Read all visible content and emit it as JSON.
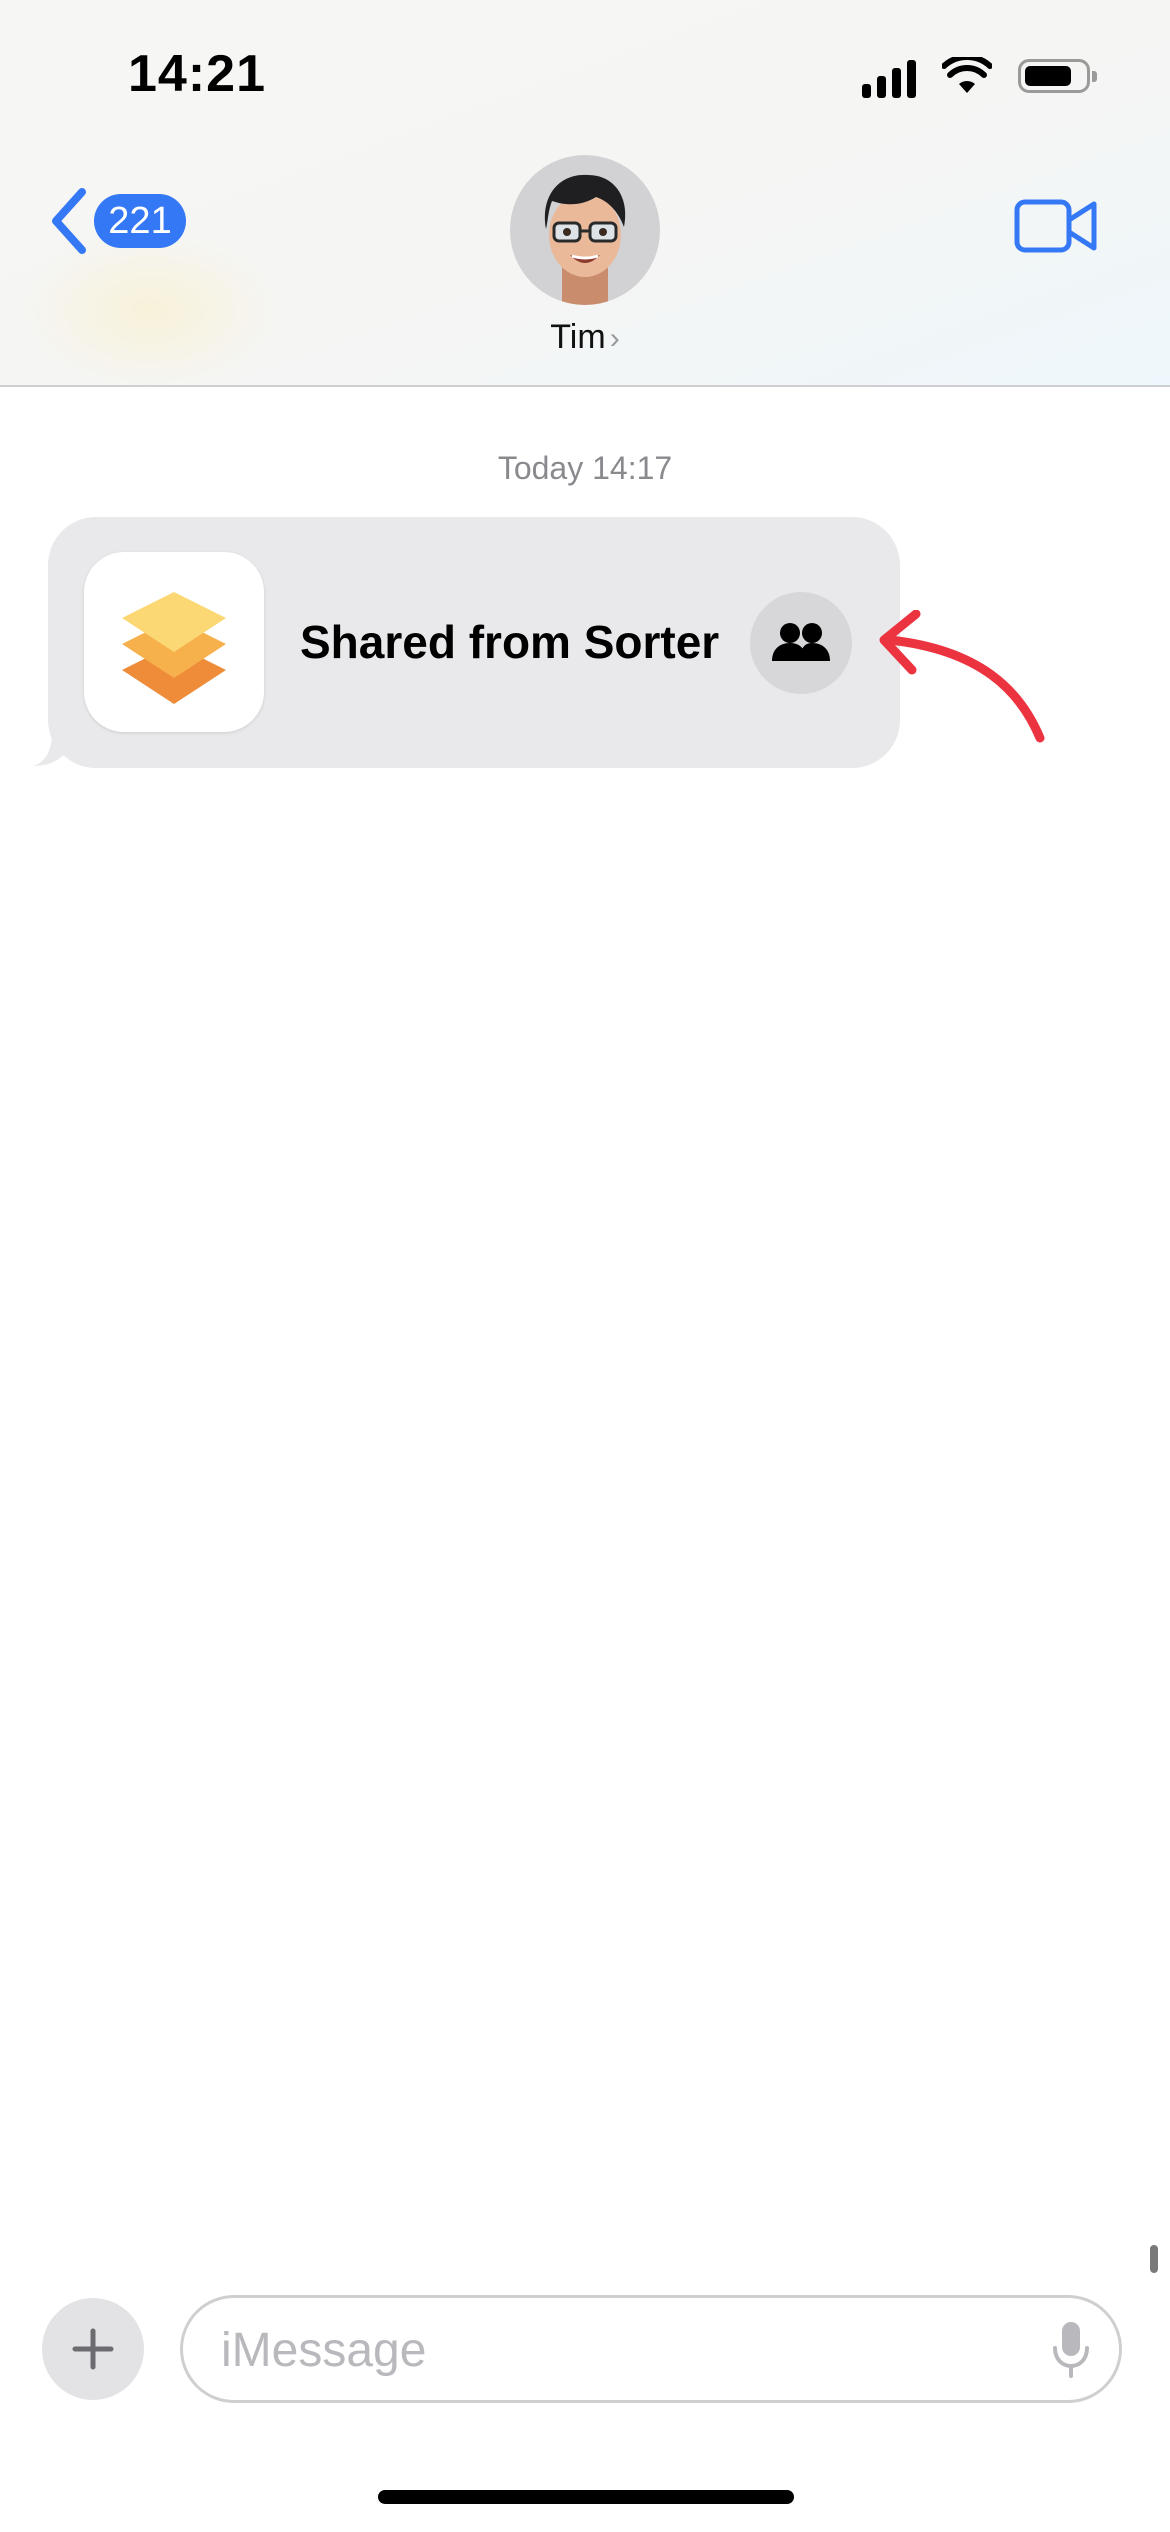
{
  "status_bar": {
    "time": "14:21"
  },
  "header": {
    "back_badge_count": "221",
    "contact_name": "Tim",
    "contact_chevron": "›",
    "accent_color": "#3478f6"
  },
  "conversation": {
    "timestamp": "Today 14:17",
    "message": {
      "title": "Shared from Sorter",
      "app_icon": "sorter-app-icon",
      "action_icon": "people-icon"
    },
    "annotation_color": "#ec3440"
  },
  "composer": {
    "placeholder": "iMessage",
    "plus_icon": "plus-icon",
    "mic_icon": "microphone-icon"
  }
}
